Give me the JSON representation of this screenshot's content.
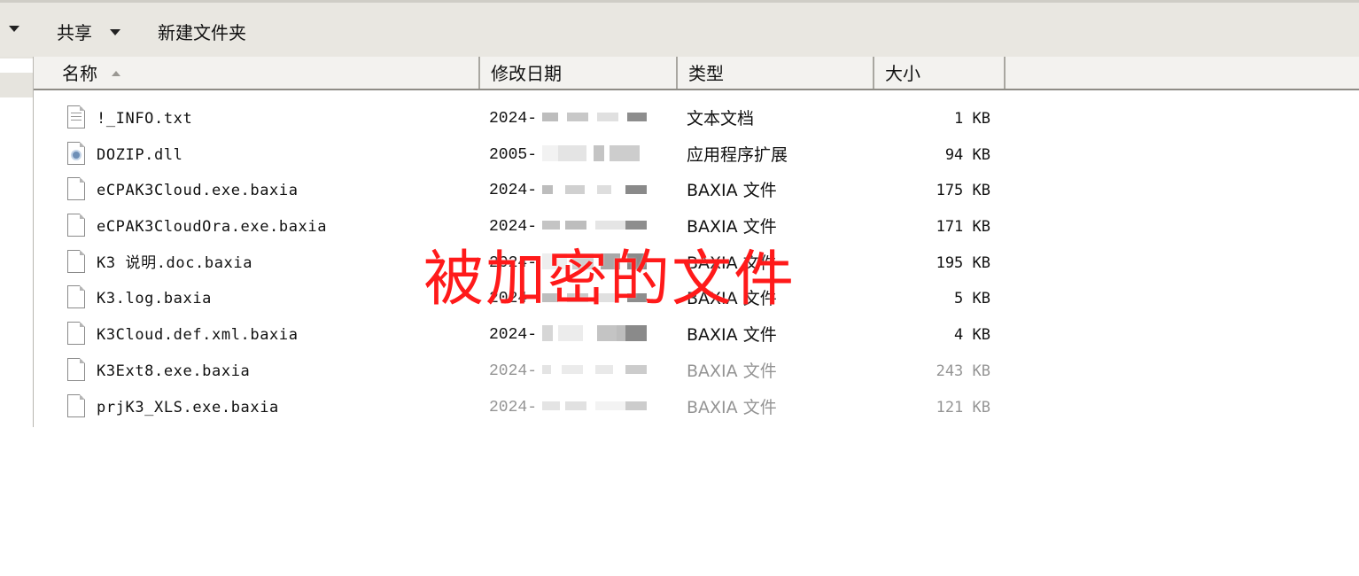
{
  "toolbar": {
    "share_label": "共享",
    "new_folder_label": "新建文件夹"
  },
  "columns": {
    "name": "名称",
    "date": "修改日期",
    "type": "类型",
    "size": "大小"
  },
  "files": [
    {
      "name": "!_INFO.txt",
      "date_prefix": "2024-",
      "type": "文本文档",
      "size": "1 KB",
      "icon": "text-file-icon"
    },
    {
      "name": "DOZIP.dll",
      "date_prefix": "2005-",
      "type": "应用程序扩展",
      "size": "94 KB",
      "icon": "dll-file-icon"
    },
    {
      "name": "eCPAK3Cloud.exe.baxia",
      "date_prefix": "2024-",
      "type": "BAXIA 文件",
      "size": "175 KB",
      "icon": "blank-file-icon"
    },
    {
      "name": "eCPAK3CloudOra.exe.baxia",
      "date_prefix": "2024-",
      "type": "BAXIA 文件",
      "size": "171 KB",
      "icon": "blank-file-icon"
    },
    {
      "name": "K3 说明.doc.baxia",
      "date_prefix": "2024-",
      "type": "BAXIA 文件",
      "size": "195 KB",
      "icon": "blank-file-icon"
    },
    {
      "name": "K3.log.baxia",
      "date_prefix": "2024-",
      "type": "BAXIA 文件",
      "size": "5 KB",
      "icon": "blank-file-icon"
    },
    {
      "name": "K3Cloud.def.xml.baxia",
      "date_prefix": "2024-",
      "type": "BAXIA 文件",
      "size": "4 KB",
      "icon": "blank-file-icon"
    },
    {
      "name": "K3Ext8.exe.baxia",
      "date_prefix": "2024-",
      "type": "BAXIA 文件",
      "size": "243 KB",
      "icon": "blank-file-icon"
    },
    {
      "name": "prjK3_XLS.exe.baxia",
      "date_prefix": "2024-",
      "type": "BAXIA 文件",
      "size": "121 KB",
      "icon": "blank-file-icon"
    }
  ],
  "annotation": {
    "text": "被加密的文件",
    "color": "#ff1a1a"
  }
}
